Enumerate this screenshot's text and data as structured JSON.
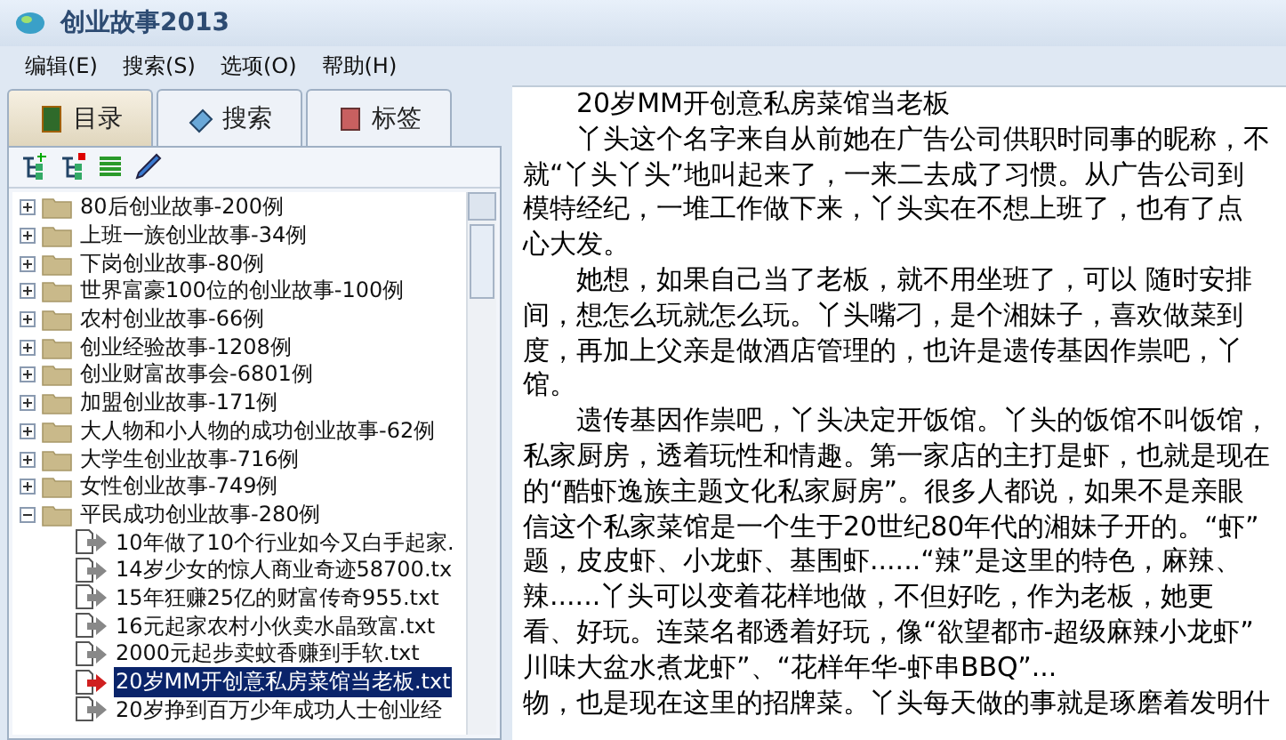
{
  "window": {
    "title": "创业故事2013"
  },
  "menu": [
    "编辑(E)",
    "搜索(S)",
    "选项(O)",
    "帮助(H)"
  ],
  "tabs": [
    {
      "label": "目录",
      "selected": true
    },
    {
      "label": "搜索",
      "selected": false
    },
    {
      "label": "标签",
      "selected": false
    }
  ],
  "tree": [
    {
      "label": "80后创业故事-200例",
      "expanded": false
    },
    {
      "label": "上班一族创业故事-34例",
      "expanded": false
    },
    {
      "label": "下岗创业故事-80例",
      "expanded": false
    },
    {
      "label": "世界富豪100位的创业故事-100例",
      "expanded": false
    },
    {
      "label": "农村创业故事-66例",
      "expanded": false
    },
    {
      "label": "创业经验故事-1208例",
      "expanded": false
    },
    {
      "label": "创业财富故事会-6801例",
      "expanded": false
    },
    {
      "label": "加盟创业故事-171例",
      "expanded": false
    },
    {
      "label": "大人物和小人物的成功创业故事-62例",
      "expanded": false
    },
    {
      "label": "大学生创业故事-716例",
      "expanded": false
    },
    {
      "label": "女性创业故事-749例",
      "expanded": false
    },
    {
      "label": "平民成功创业故事-280例",
      "expanded": true,
      "children": [
        {
          "label": "10年做了10个行业如今又白手起家.",
          "selected": false
        },
        {
          "label": "14岁少女的惊人商业奇迹58700.tx",
          "selected": false
        },
        {
          "label": "15年狂赚25亿的财富传奇955.txt",
          "selected": false
        },
        {
          "label": "16元起家农村小伙卖水晶致富.txt",
          "selected": false
        },
        {
          "label": "2000元起步卖蚊香赚到手软.txt",
          "selected": false
        },
        {
          "label": "20岁MM开创意私房菜馆当老板.txt",
          "selected": true
        },
        {
          "label": "20岁挣到百万少年成功人士创业经",
          "selected": false
        }
      ]
    }
  ],
  "article": [
    {
      "text": "20岁MM开创意私房菜馆当老板",
      "indent": true
    },
    {
      "text": "丫头这个名字来自从前她在广告公司供职时同事的昵称，不",
      "indent": true
    },
    {
      "text": "就“丫头丫头”地叫起来了，一来二去成了习惯。从广告公司到",
      "indent": false
    },
    {
      "text": "模特经纪，一堆工作做下来，丫头实在不想上班了，也有了点",
      "indent": false
    },
    {
      "text": "心大发。",
      "indent": false
    },
    {
      "text": "她想，如果自己当了老板，就不用坐班了，可以 随时安排",
      "indent": true
    },
    {
      "text": "间，想怎么玩就怎么玩。丫头嘴刁，是个湘妹子，喜欢做菜到",
      "indent": false
    },
    {
      "text": "度，再加上父亲是做酒店管理的，也许是遗传基因作祟吧，丫",
      "indent": false
    },
    {
      "text": "馆。",
      "indent": false
    },
    {
      "text": "遗传基因作祟吧，丫头决定开饭馆。丫头的饭馆不叫饭馆，",
      "indent": true
    },
    {
      "text": "私家厨房，透着玩性和情趣。第一家店的主打是虾，也就是现在",
      "indent": false
    },
    {
      "text": "的“酷虾逸族主题文化私家厨房”。很多人都说，如果不是亲眼",
      "indent": false
    },
    {
      "text": "信这个私家菜馆是一个生于20世纪80年代的湘妹子开的。“虾”",
      "indent": false
    },
    {
      "text": "题，皮皮虾、小龙虾、基围虾......“辣”是这里的特色，麻辣、",
      "indent": false
    },
    {
      "text": "辣......丫头可以变着花样地做，不但好吃，作为老板，她更",
      "indent": false
    },
    {
      "text": "看、好玩。连菜名都透着好玩，像“欲望都市-超级麻辣小龙虾”",
      "indent": false
    },
    {
      "text": "川味大盆水煮龙虾”、“花样年华-虾串BBQ”...",
      "indent": false
    },
    {
      "text": "物，也是现在这里的招牌菜。丫头每天做的事就是琢磨着发明什",
      "indent": false
    }
  ]
}
